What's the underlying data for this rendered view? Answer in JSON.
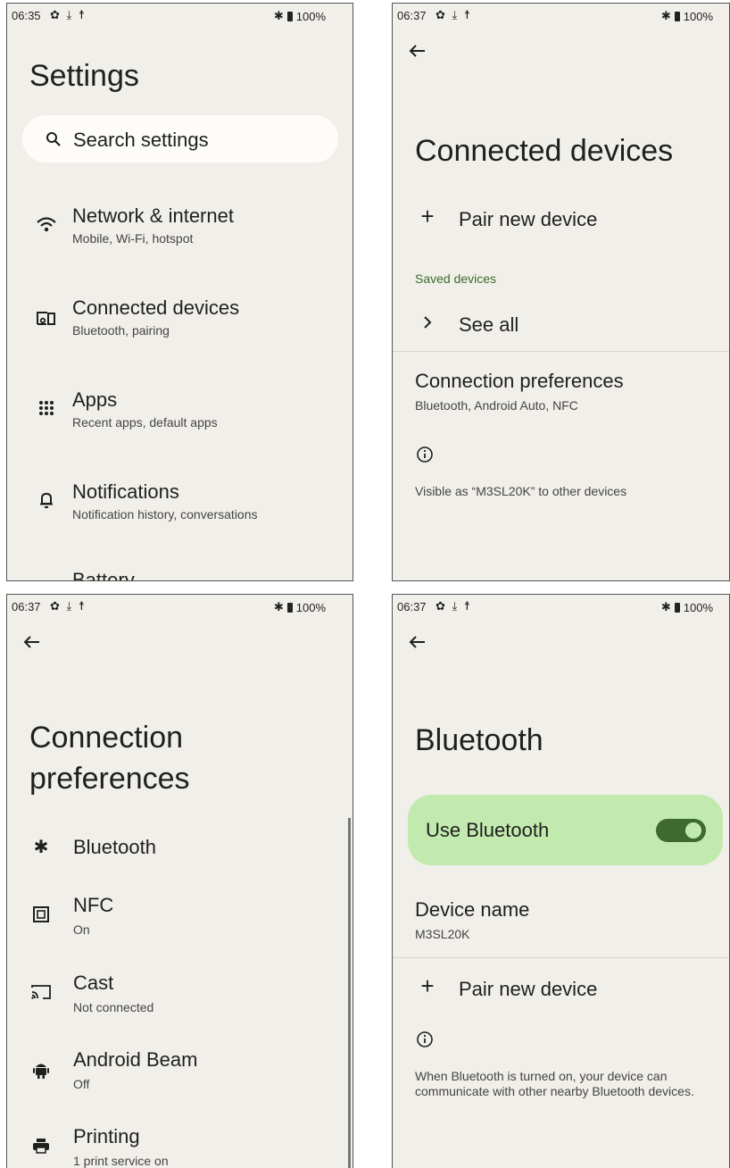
{
  "screen1": {
    "status": {
      "time": "06:35",
      "battery": "100%"
    },
    "title": "Settings",
    "search_placeholder": "Search settings",
    "items": [
      {
        "title": "Network & internet",
        "subtitle": "Mobile, Wi-Fi, hotspot",
        "icon": "wifi-icon"
      },
      {
        "title": "Connected devices",
        "subtitle": "Bluetooth, pairing",
        "icon": "devices-icon"
      },
      {
        "title": "Apps",
        "subtitle": "Recent apps, default apps",
        "icon": "apps-grid-icon"
      },
      {
        "title": "Notifications",
        "subtitle": "Notification history, conversations",
        "icon": "bell-icon"
      },
      {
        "title": "Battery",
        "icon": ""
      }
    ]
  },
  "screen2": {
    "status": {
      "time": "06:37",
      "battery": "100%"
    },
    "title": "Connected devices",
    "pair_new": "Pair new device",
    "saved_devices_label": "Saved devices",
    "see_all": "See all",
    "connection_prefs": {
      "title": "Connection preferences",
      "subtitle": "Bluetooth, Android Auto, NFC"
    },
    "visible_text": "Visible as “M3SL20K” to other devices"
  },
  "screen3": {
    "status": {
      "time": "06:37",
      "battery": "100%"
    },
    "title_line1": "Connection",
    "title_line2": "preferences",
    "items": [
      {
        "title": "Bluetooth",
        "subtitle": "",
        "icon": "bluetooth-icon"
      },
      {
        "title": "NFC",
        "subtitle": "On",
        "icon": "nfc-icon"
      },
      {
        "title": "Cast",
        "subtitle": "Not connected",
        "icon": "cast-icon"
      },
      {
        "title": "Android Beam",
        "subtitle": "Off",
        "icon": "android-icon"
      },
      {
        "title": "Printing",
        "subtitle": "1 print service on",
        "icon": "printer-icon"
      }
    ]
  },
  "screen4": {
    "status": {
      "time": "06:37",
      "battery": "100%"
    },
    "title": "Bluetooth",
    "use_bluetooth": "Use Bluetooth",
    "use_bluetooth_on": true,
    "device_name_label": "Device name",
    "device_name_value": "M3SL20K",
    "pair_new": "Pair new device",
    "info_text": "When Bluetooth is turned on, your device can communicate with other nearby Bluetooth devices."
  },
  "colors": {
    "background": "#f1efe9",
    "card_green": "#c2eaae",
    "toggle_green": "#3e6a2e",
    "label_green": "#3b6b2c"
  }
}
